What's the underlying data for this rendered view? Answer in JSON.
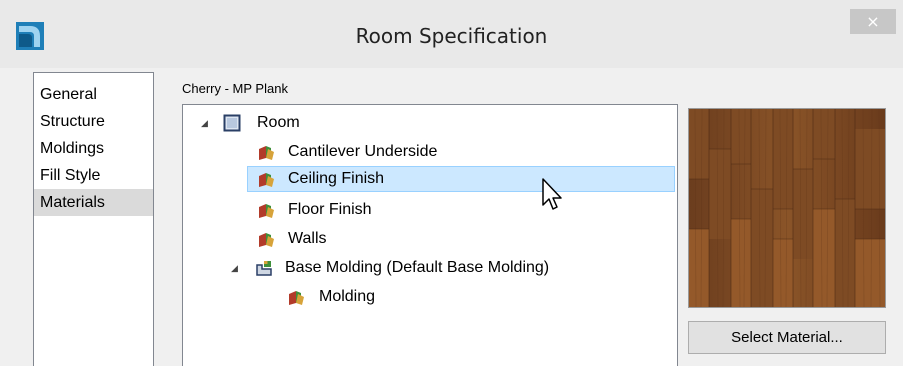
{
  "window": {
    "title": "Room Specification",
    "close_glyph": "×"
  },
  "nav": {
    "items": [
      {
        "label": "General"
      },
      {
        "label": "Structure"
      },
      {
        "label": "Moldings"
      },
      {
        "label": "Fill Style"
      },
      {
        "label": "Materials",
        "selected": true
      }
    ]
  },
  "material_name": "Cherry - MP Plank",
  "tree": {
    "items": [
      {
        "label": "Room",
        "icon": "room-icon",
        "expanded": true
      },
      {
        "label": "Cantilever Underside",
        "icon": "material-swatch-icon"
      },
      {
        "label": "Ceiling Finish",
        "icon": "material-swatch-icon",
        "selected": true
      },
      {
        "label": "Floor Finish",
        "icon": "material-swatch-icon"
      },
      {
        "label": "Walls",
        "icon": "material-swatch-icon"
      },
      {
        "label": "Base Molding (Default Base Molding)",
        "icon": "molding-icon",
        "expanded": true
      },
      {
        "label": "Molding",
        "icon": "material-swatch-icon"
      }
    ]
  },
  "preview": {
    "material": "cherry wood plank",
    "accent": "#7a4a24"
  },
  "buttons": {
    "select_material": "Select Material..."
  },
  "colors": {
    "selection_bg": "#cce8ff",
    "selection_border": "#99d1ff",
    "nav_selected": "#dadada"
  }
}
